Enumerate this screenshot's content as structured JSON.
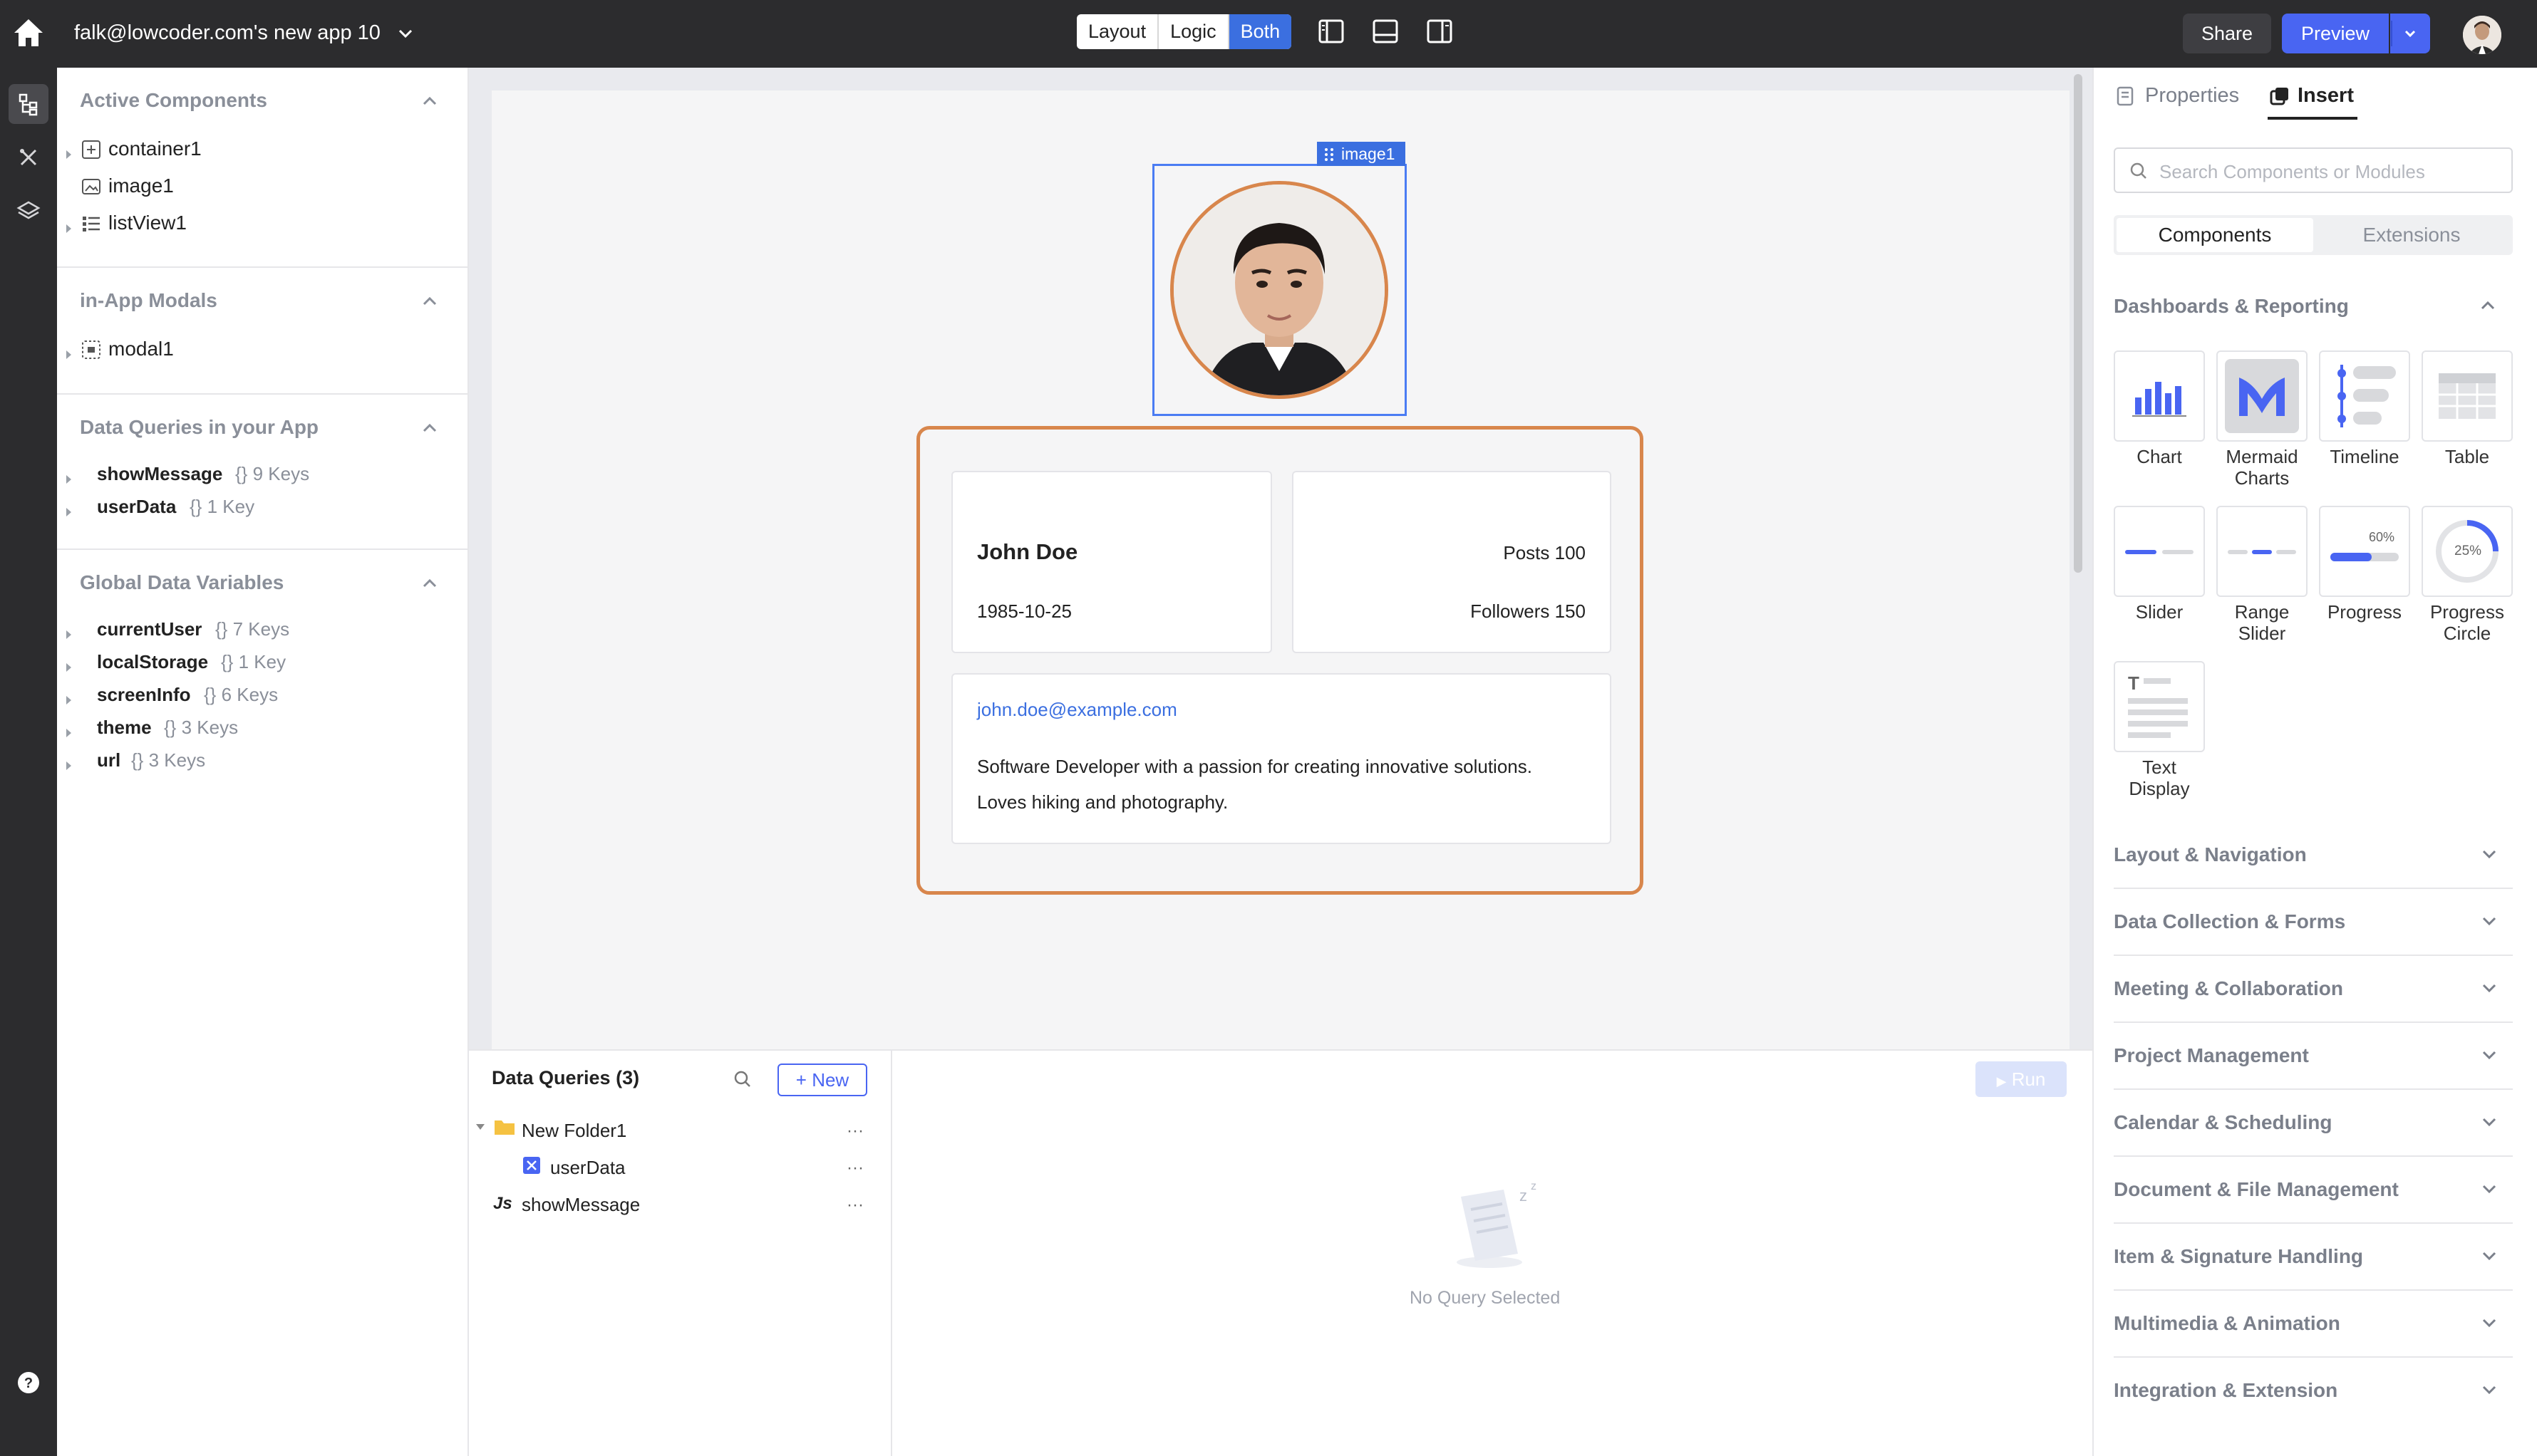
{
  "topbar": {
    "app_title": "falk@lowcoder.com's new app 10",
    "modes": [
      "Layout",
      "Logic",
      "Both"
    ],
    "active_mode": "Both",
    "share_label": "Share",
    "preview_label": "Preview"
  },
  "left_panel": {
    "active_components": {
      "title": "Active Components",
      "items": [
        "container1",
        "image1",
        "listView1"
      ]
    },
    "modals": {
      "title": "in-App Modals",
      "items": [
        "modal1"
      ]
    },
    "queries": {
      "title": "Data Queries in your App",
      "items": [
        {
          "name": "showMessage",
          "keys": "{} 9 Keys"
        },
        {
          "name": "userData",
          "keys": "{} 1 Key"
        }
      ]
    },
    "globals": {
      "title": "Global Data Variables",
      "items": [
        {
          "name": "currentUser",
          "keys": "{} 7 Keys"
        },
        {
          "name": "localStorage",
          "keys": "{} 1 Key"
        },
        {
          "name": "screenInfo",
          "keys": "{} 6 Keys"
        },
        {
          "name": "theme",
          "keys": "{} 3 Keys"
        },
        {
          "name": "url",
          "keys": "{} 3 Keys"
        }
      ]
    }
  },
  "canvas": {
    "image_tag": "image1",
    "profile": {
      "name": "John Doe",
      "birthdate": "1985-10-25",
      "posts": "Posts 100",
      "followers": "Followers 150",
      "email": "john.doe@example.com",
      "bio_line1": "Software Developer with a passion for creating innovative solutions.",
      "bio_line2": "Loves hiking and photography."
    }
  },
  "bottom": {
    "title": "Data Queries (3)",
    "new_label": "+ New",
    "folder": "New Folder1",
    "queries": [
      "userData",
      "showMessage"
    ],
    "run_label": "Run",
    "empty_text": "No Query Selected"
  },
  "right_panel": {
    "tabs": [
      "Properties",
      "Insert"
    ],
    "active_tab": "Insert",
    "search_placeholder": "Search Components or Modules",
    "segments": [
      "Components",
      "Extensions"
    ],
    "section_title": "Dashboards & Reporting",
    "components": [
      {
        "label_line1": "Chart",
        "label_line2": ""
      },
      {
        "label_line1": "Mermaid",
        "label_line2": "Charts"
      },
      {
        "label_line1": "Timeline",
        "label_line2": ""
      },
      {
        "label_line1": "Table",
        "label_line2": ""
      },
      {
        "label_line1": "Slider",
        "label_line2": ""
      },
      {
        "label_line1": "Range",
        "label_line2": "Slider"
      },
      {
        "label_line1": "Progress",
        "label_line2": ""
      },
      {
        "label_line1": "Progress",
        "label_line2": "Circle"
      },
      {
        "label_line1": "Text",
        "label_line2": "Display"
      }
    ],
    "progress_badge": "60%",
    "progress_circle_badge": "25%",
    "categories": [
      "Layout & Navigation",
      "Data Collection & Forms",
      "Meeting & Collaboration",
      "Project Management",
      "Calendar & Scheduling",
      "Document & File Management",
      "Item & Signature Handling",
      "Multimedia & Animation",
      "Integration & Extension"
    ]
  },
  "colors": {
    "accent": "#4965f2",
    "selection": "#3b6fe0",
    "card_border": "#d8864c",
    "topbar": "#2c2c2e"
  }
}
